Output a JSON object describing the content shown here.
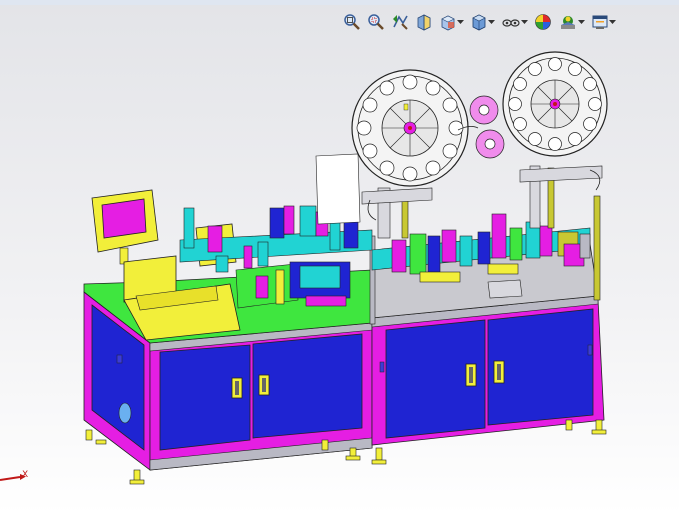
{
  "app": {
    "kind": "solidworks-graphics-area"
  },
  "toolbar": {
    "items": [
      {
        "icon": "zoom-to-fit-icon",
        "dropdown": false
      },
      {
        "icon": "zoom-to-area-icon",
        "dropdown": false
      },
      {
        "icon": "previous-view-icon",
        "dropdown": false
      },
      {
        "icon": "section-view-icon",
        "dropdown": false
      },
      {
        "icon": "view-orientation-icon",
        "dropdown": true
      },
      {
        "icon": "display-style-icon",
        "dropdown": true
      },
      {
        "icon": "hide-show-items-icon",
        "dropdown": true
      },
      {
        "icon": "edit-appearance-icon",
        "dropdown": false
      },
      {
        "icon": "apply-scene-icon",
        "dropdown": true
      },
      {
        "icon": "view-settings-icon",
        "dropdown": true
      }
    ]
  },
  "triad": {
    "axis_label": "X"
  },
  "colors": {
    "frame_blue": "#1f24d2",
    "frame_magenta": "#e51ee3",
    "table_green": "#3fe63f",
    "yellow_parts": "#f2ef3a",
    "cyan_parts": "#21d3d3",
    "background_top": "#e3e4e8",
    "background_bottom": "#ffffff"
  }
}
